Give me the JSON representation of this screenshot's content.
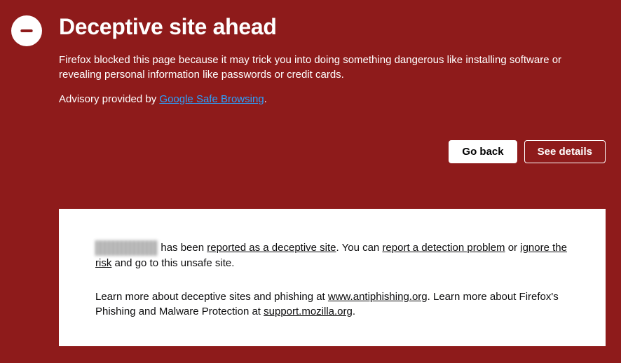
{
  "header": {
    "title": "Deceptive site ahead"
  },
  "body": {
    "blocked_text": "Firefox blocked this page because it may trick you into doing something dangerous like installing software or revealing personal information like passwords or credit cards.",
    "advisory_prefix": "Advisory provided by ",
    "advisory_link_text": "Google Safe Browsing",
    "advisory_suffix": "."
  },
  "buttons": {
    "go_back": "Go back",
    "see_details": "See details"
  },
  "details": {
    "p1": {
      "site_redacted": "██████ ██",
      "t1": " has been ",
      "link_reported": "reported as a deceptive site",
      "t2": ". You can ",
      "link_report_problem": "report a detection problem",
      "t3": " or ",
      "link_ignore": "ignore the risk",
      "t4": " and go to this unsafe site."
    },
    "p2": {
      "t1": "Learn more about deceptive sites and phishing at ",
      "link_antiphishing": "www.antiphishing.org",
      "t2": ". Learn more about Firefox's Phishing and Malware Protection at ",
      "link_support": "support.mozilla.org",
      "t3": "."
    }
  }
}
